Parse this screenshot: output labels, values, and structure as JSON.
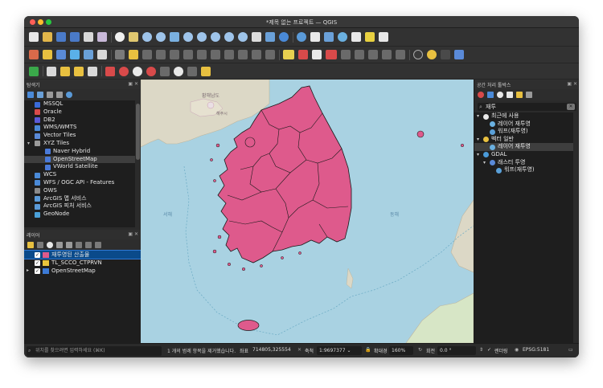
{
  "window": {
    "title": "*제목 없는 프로젝트 — QGIS"
  },
  "colors": {
    "sea": "#a9d2e2",
    "land": "#dcd8c6",
    "korea_fill": "#de5a8c",
    "korea_stroke": "#1a1a1a",
    "panel_bg": "#2b2b2b",
    "selection": "#0a4a8a"
  },
  "browser": {
    "title": "탐색기",
    "items": [
      {
        "label": "MSSQL",
        "icon": "mssql-icon"
      },
      {
        "label": "Oracle",
        "icon": "oracle-icon"
      },
      {
        "label": "DB2",
        "icon": "db2-icon"
      },
      {
        "label": "WMS/WMTS",
        "icon": "globe-icon"
      },
      {
        "label": "Vector Tiles",
        "icon": "vector-tiles-icon"
      },
      {
        "label": "XYZ Tiles",
        "icon": "xyz-grid-icon",
        "expanded": true
      },
      {
        "label": "Naver Hybrid",
        "icon": "grid-icon",
        "child": true
      },
      {
        "label": "OpenStreetMap",
        "icon": "grid-icon",
        "child": true,
        "selected": true
      },
      {
        "label": "VWorld Satellite",
        "icon": "grid-icon",
        "child": true
      },
      {
        "label": "WCS",
        "icon": "globe-icon"
      },
      {
        "label": "WFS / OGC API - Features",
        "icon": "globe-icon"
      },
      {
        "label": "OWS",
        "icon": "ows-icon"
      },
      {
        "label": "ArcGIS 맵 서비스",
        "icon": "arcgis-icon"
      },
      {
        "label": "ArcGIS 피처 서비스",
        "icon": "arcgis-icon"
      },
      {
        "label": "GeoNode",
        "icon": "geonode-icon"
      }
    ]
  },
  "layers": {
    "title": "레이어",
    "items": [
      {
        "label": "재투영된 산출물",
        "checked": true,
        "swatch": "#de5a8c",
        "selected": true
      },
      {
        "label": "TL_SCCO_CTPRVN",
        "checked": true,
        "swatch": "#e8c43c"
      },
      {
        "label": "OpenStreetMap",
        "checked": true,
        "swatch": "#3c7ad6"
      }
    ]
  },
  "map": {
    "labels": [
      {
        "text": "황해남도"
      },
      {
        "text": "해주시"
      },
      {
        "text": "서해"
      },
      {
        "text": "동해"
      }
    ]
  },
  "processing": {
    "title": "공간 처리 툴박스",
    "search_value": "재투",
    "tree": [
      {
        "label": "최근에 사용",
        "level": 0,
        "icon": "clock-icon",
        "expanded": true
      },
      {
        "label": "레이어 재투영",
        "level": 1,
        "icon": "gear-icon"
      },
      {
        "label": "워프(재투영)",
        "level": 1,
        "icon": "warp-icon"
      },
      {
        "label": "벡터 일반",
        "level": 0,
        "icon": "qgis-icon",
        "expanded": true
      },
      {
        "label": "레이어 재투영",
        "level": 1,
        "icon": "gear-icon",
        "selected": true
      },
      {
        "label": "GDAL",
        "level": 0,
        "icon": "gdal-icon",
        "expanded": true
      },
      {
        "label": "래스터 투영",
        "level": 1,
        "icon": "folder-icon",
        "expanded": true
      },
      {
        "label": "워프(재투영)",
        "level": 2,
        "icon": "warp-icon"
      }
    ]
  },
  "statusbar": {
    "locator_placeholder": "위치를 찾으려면 입력하세요 (⌘K)",
    "message": "1 개의 범례 항목을 제거했습니다.",
    "coord_label": "좌표",
    "coord_value": "714805,325554",
    "scale_label": "축척",
    "scale_value": "1:9697377",
    "magnifier_label": "확대경",
    "magnifier_value": "160%",
    "rotation_label": "회전",
    "rotation_value": "0.0 °",
    "render_label": "렌더링",
    "crs": "EPSG:5181"
  }
}
